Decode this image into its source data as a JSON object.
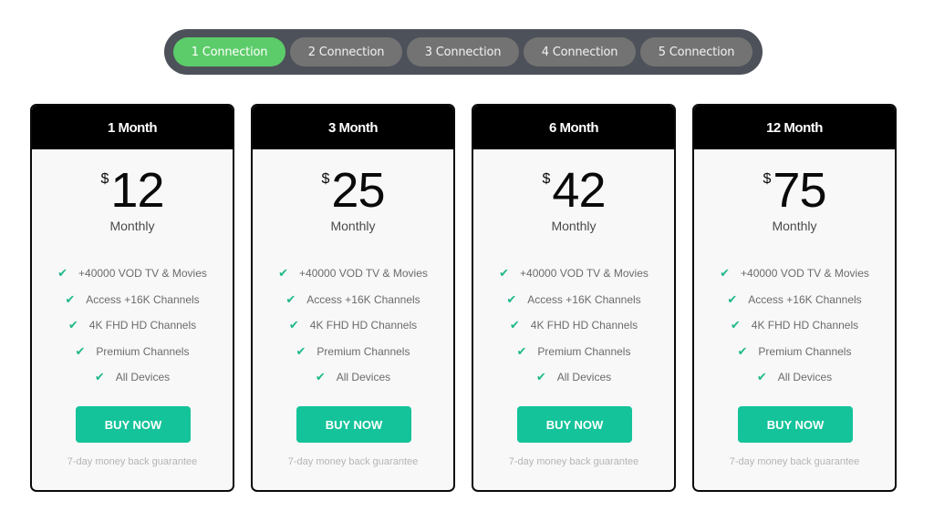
{
  "connection_tabs": [
    {
      "label": "1 Connection",
      "active": true
    },
    {
      "label": "2 Connection",
      "active": false
    },
    {
      "label": "3 Connection",
      "active": false
    },
    {
      "label": "4 Connection",
      "active": false
    },
    {
      "label": "5 Connection",
      "active": false
    }
  ],
  "colors": {
    "active_tab": "#5ccc6a",
    "inactive_tab": "#737373",
    "tab_bar": "#4d5159",
    "buy_button": "#15c39a",
    "check": "#1fb88a"
  },
  "plans": [
    {
      "title": "1 Month",
      "currency": "$",
      "price": "12",
      "period": "Monthly",
      "features": [
        "+40000 VOD TV & Movies",
        "Access +16K Channels",
        "4K FHD HD Channels",
        "Premium Channels",
        "All Devices"
      ],
      "button": "BUY NOW",
      "guarantee": "7-day money back guarantee"
    },
    {
      "title": "3 Month",
      "currency": "$",
      "price": "25",
      "period": "Monthly",
      "features": [
        "+40000 VOD TV & Movies",
        "Access +16K Channels",
        "4K FHD HD Channels",
        "Premium Channels",
        "All Devices"
      ],
      "button": "BUY NOW",
      "guarantee": "7-day money back guarantee"
    },
    {
      "title": "6 Month",
      "currency": "$",
      "price": "42",
      "period": "Monthly",
      "features": [
        "+40000 VOD TV & Movies",
        "Access +16K Channels",
        "4K FHD HD Channels",
        "Premium Channels",
        "All Devices"
      ],
      "button": "BUY NOW",
      "guarantee": "7-day money back guarantee"
    },
    {
      "title": "12 Month",
      "currency": "$",
      "price": "75",
      "period": "Monthly",
      "features": [
        "+40000 VOD TV & Movies",
        "Access +16K Channels",
        "4K FHD HD Channels",
        "Premium Channels",
        "All Devices"
      ],
      "button": "BUY NOW",
      "guarantee": "7-day money back guarantee"
    }
  ],
  "icons": {
    "check": "check-icon"
  }
}
